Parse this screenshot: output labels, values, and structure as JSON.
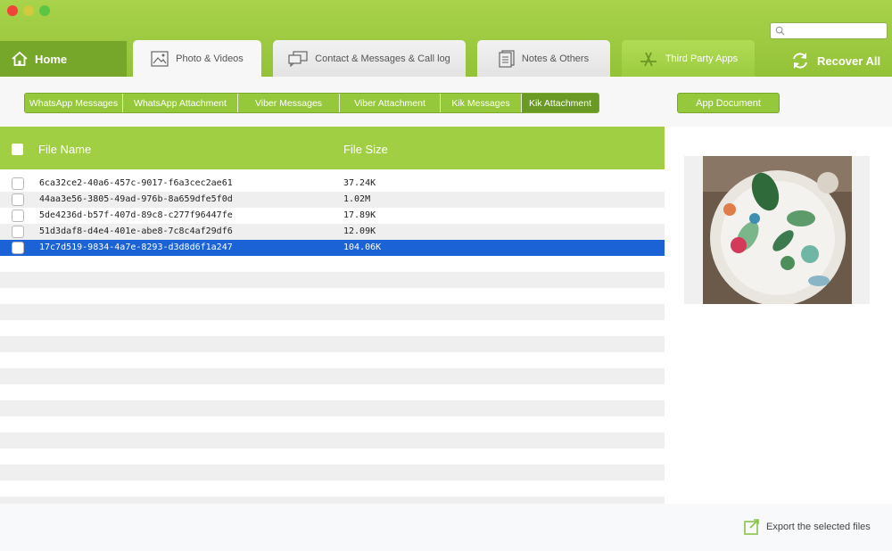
{
  "header": {
    "search_placeholder": "",
    "home_label": "Home",
    "recover_label": "Recover  All"
  },
  "tabs": [
    {
      "label": "Photo & Videos",
      "icon": "photo-icon"
    },
    {
      "label": "Contact & Messages & Call log",
      "icon": "messages-icon"
    },
    {
      "label": "Notes & Others",
      "icon": "notes-icon"
    },
    {
      "label": "Third Party Apps",
      "icon": "app-store-icon"
    }
  ],
  "subtabs": [
    {
      "label": "WhatsApp Messages"
    },
    {
      "label": "WhatsApp Attachment"
    },
    {
      "label": "Viber Messages"
    },
    {
      "label": "Viber Attachment"
    },
    {
      "label": "Kik Messages"
    },
    {
      "label": "Kik Attachment"
    }
  ],
  "app_document_label": "App Document",
  "table": {
    "col_name": "File Name",
    "col_size": "File Size",
    "rows": [
      {
        "name": "6ca32ce2-40a6-457c-9017-f6a3cec2ae61",
        "size": "37.24K"
      },
      {
        "name": "44aa3e56-3805-49ad-976b-8a659dfe5f0d",
        "size": "1.02M"
      },
      {
        "name": "5de4236d-b57f-407d-89c8-c277f96447fe",
        "size": "17.89K"
      },
      {
        "name": "51d3daf8-d4e4-401e-abe8-7c8c4af29df6",
        "size": "12.09K"
      },
      {
        "name": "17c7d519-9834-4a7e-8293-d3d8d6f1a247",
        "size": "104.06K"
      }
    ]
  },
  "footer": {
    "export_label": "Export the selected files"
  },
  "colors": {
    "accent": "#9ccb3f",
    "selected_row": "#1a62d6"
  }
}
